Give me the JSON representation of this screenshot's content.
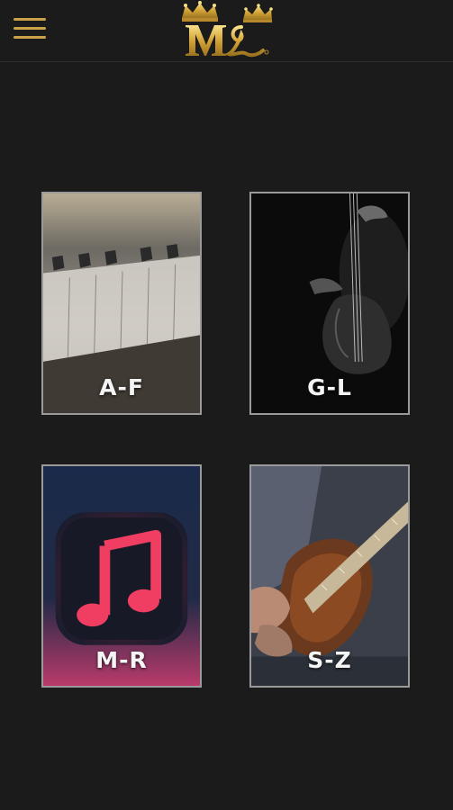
{
  "header": {
    "menu_icon": "hamburger-menu-icon",
    "logo_text": "ML",
    "accent_color": "#c9a24a"
  },
  "tiles": [
    {
      "label": "A-F",
      "image": "piano-keys"
    },
    {
      "label": "G-L",
      "image": "upright-bass-player"
    },
    {
      "label": "M-R",
      "image": "music-note-app-icon"
    },
    {
      "label": "S-Z",
      "image": "electric-guitar-player"
    }
  ]
}
